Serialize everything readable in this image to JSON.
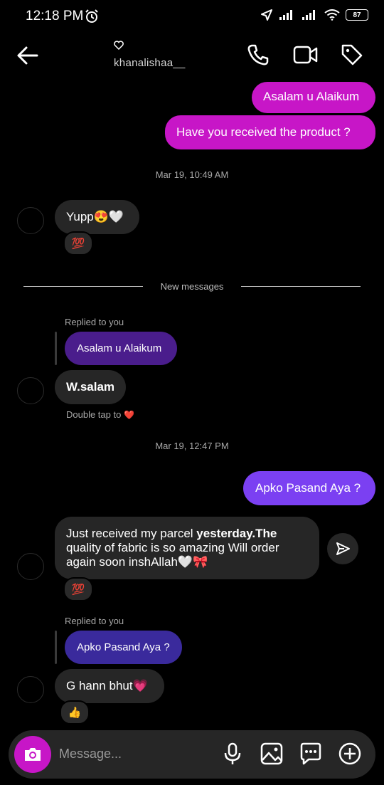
{
  "status_bar": {
    "time": "12:18 PM",
    "battery": "87"
  },
  "header": {
    "username": "khanalishaa__"
  },
  "messages": {
    "out1": "Asalam u Alaikum",
    "out2": "Have you received the product ?",
    "date1": "Mar 19, 10:49 AM",
    "in1": "Yupp😍🤍",
    "reaction_100": "💯",
    "new_messages": "New messages",
    "replied_label": "Replied to you",
    "reply_quote1": "Asalam u Alaikum",
    "in2": "W.salam",
    "double_tap": "Double tap to",
    "double_tap_heart": "❤️",
    "date2": "Mar 19, 12:47 PM",
    "out3": "Apko Pasand Aya ?",
    "in3_part1": "Just received my parcel ",
    "in3_bold": "yesterday.The",
    "in3_line2": "quality of fabric is so amazing Will order",
    "in3_line3": "again soon inshAllah🤍🎀",
    "reply_quote2": "Apko Pasand Aya ?",
    "in4": "G hann bhut💗",
    "reaction_thumb": "👍"
  },
  "composer": {
    "placeholder": "Message..."
  },
  "colors": {
    "outgoing_magenta": "#c716c7",
    "outgoing_purple": "#7b40f2",
    "incoming": "#262626",
    "reply_quote_1": "#4a1d8c",
    "reply_quote_2": "#3a2a9c"
  }
}
